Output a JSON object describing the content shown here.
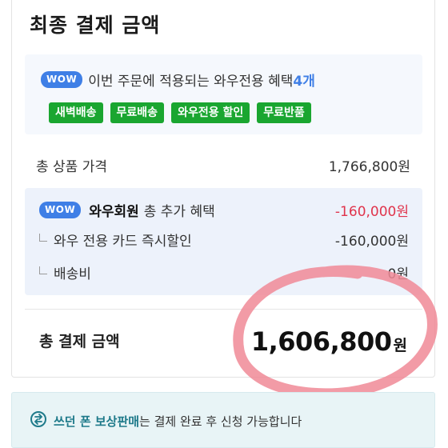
{
  "page": {
    "title": "최종 결제 금액"
  },
  "wow_benefits": {
    "badge": "WOW",
    "text_prefix": "이번 주문에 적용되는 와우전용 혜택",
    "count": "4개",
    "tags": [
      "새벽배송",
      "무료배송",
      "와우전용 할인",
      "무료반품"
    ]
  },
  "summary": {
    "total_goods_label": "총 상품 가격",
    "total_goods_value": "1,766,800원"
  },
  "member_benefit": {
    "badge": "WOW",
    "member_label": "와우회원",
    "label_suffix": "총 추가 혜택",
    "value": "-160,000원",
    "items": [
      {
        "label": "와우 전용 카드 즉시할인",
        "value": "-160,000원"
      },
      {
        "label": "배송비",
        "value": "0원"
      }
    ]
  },
  "final": {
    "label": "총 결제 금액",
    "amount": "1,606,800",
    "unit": "원"
  },
  "banner": {
    "highlight": "쓰던 폰 보상판매",
    "text": "는 결제 완료 후 신청 가능합니다"
  },
  "colors": {
    "wow_blue": "#3f7fe6",
    "tag_green": "#1aa630",
    "discount_red": "#e0344c",
    "annotation_circle": "#f08a96"
  }
}
